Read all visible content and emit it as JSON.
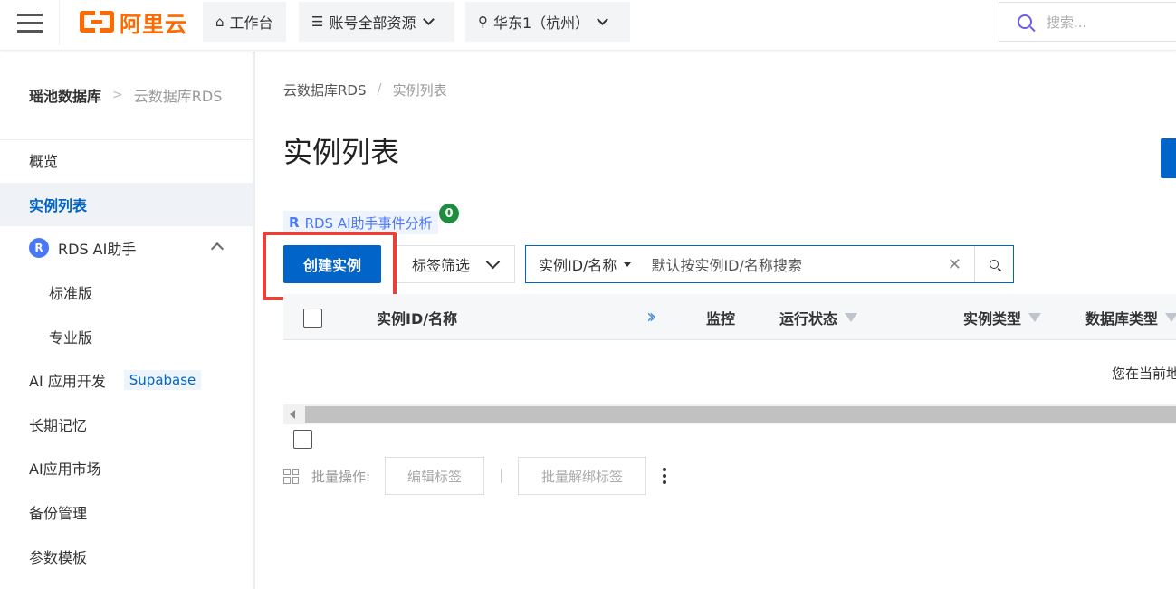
{
  "topbar": {
    "logo_text": "阿里云",
    "workbench": "工作台",
    "resources": "账号全部资源",
    "region": "华东1（杭州）",
    "search_placeholder": "搜索..."
  },
  "sidebar": {
    "breadcrumb_root": "瑶池数据库",
    "breadcrumb_sep": ">",
    "breadcrumb_current": "云数据库RDS",
    "items": [
      {
        "label": "概览"
      },
      {
        "label": "实例列表"
      },
      {
        "label": "RDS AI助手"
      },
      {
        "label": "标准版"
      },
      {
        "label": "专业版"
      },
      {
        "label": "AI 应用开发",
        "badge": "Supabase"
      },
      {
        "label": "长期记忆"
      },
      {
        "label": "AI应用市场"
      },
      {
        "label": "备份管理"
      },
      {
        "label": "参数模板"
      }
    ]
  },
  "main": {
    "breadcrumb": [
      "云数据库RDS",
      "实例列表"
    ],
    "breadcrumb_sep": "/",
    "title": "实例列表",
    "ai_tag": "RDS AI助手事件分析",
    "ai_badge": "0",
    "create_button": "创建实例",
    "tag_filter": "标签筛选",
    "search_select": "实例ID/名称",
    "search_placeholder": "默认按实例ID/名称搜索",
    "columns": [
      "实例ID/名称",
      "监控",
      "运行状态",
      "实例类型",
      "数据库类型"
    ],
    "empty_text": "您在当前地",
    "batch_label": "批量操作:",
    "edit_tags": "编辑标签",
    "unbind_tags": "批量解绑标签"
  },
  "colors": {
    "accent": "#0064c8",
    "brand": "#ff6a00",
    "highlight": "#e8413a",
    "badge": "#1e8e3e"
  }
}
